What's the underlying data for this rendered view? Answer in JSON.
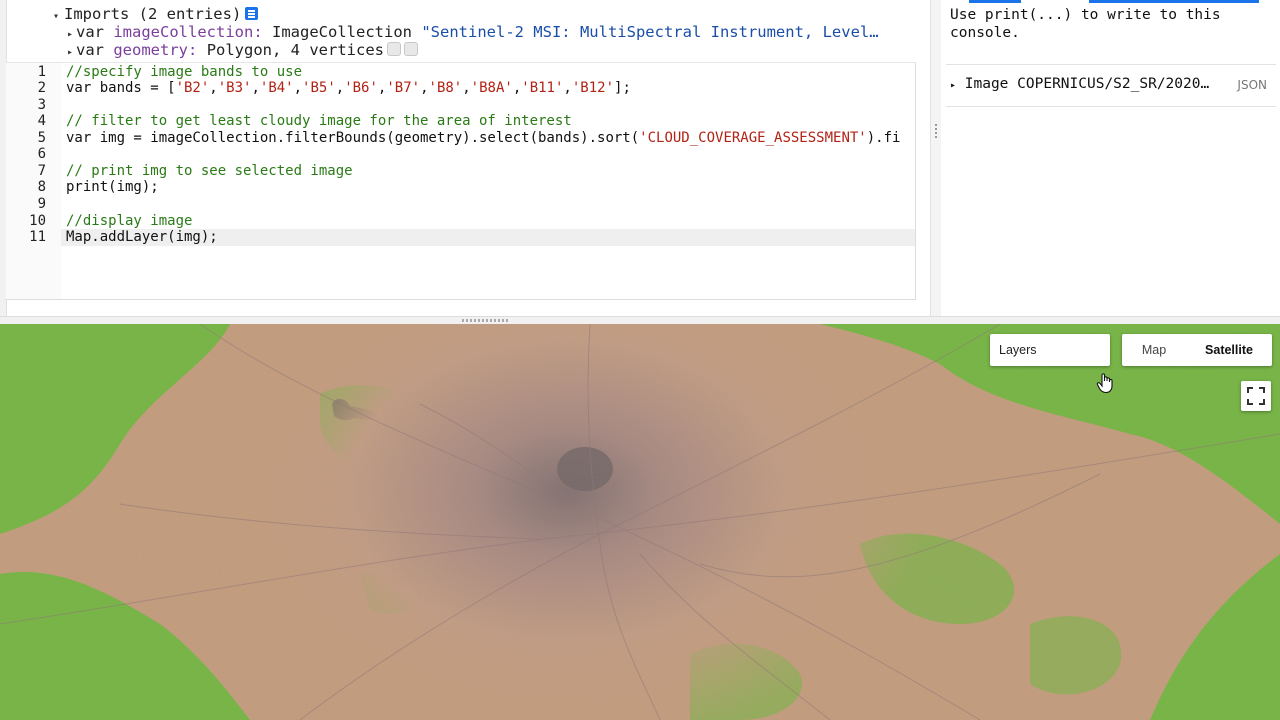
{
  "imports": {
    "header": "Imports (2 entries)",
    "line1": {
      "keyword": "var",
      "name": "imageCollection:",
      "type": "ImageCollection",
      "value": "\"Sentinel-2 MSI: MultiSpectral Instrument, Level…"
    },
    "line2": {
      "keyword": "var",
      "name": "geometry:",
      "type": "Polygon, 4 vertices"
    }
  },
  "code": {
    "line_numbers": [
      "1",
      "2",
      "3",
      "4",
      "5",
      "6",
      "7",
      "8",
      "9",
      "10",
      "11"
    ],
    "l1": "//specify image bands to use",
    "l2_pre": "var bands = [",
    "l2_bands": [
      "'B2'",
      "'B3'",
      "'B4'",
      "'B5'",
      "'B6'",
      "'B7'",
      "'B8'",
      "'B8A'",
      "'B11'",
      "'B12'"
    ],
    "l2_post": "];",
    "l4": "// filter to get least cloudy image for the area of interest",
    "l5_a": "var img = imageCollection.filterBounds(geometry).select(bands).sort(",
    "l5_str": "'CLOUD_COVERAGE_ASSESSMENT'",
    "l5_b": ").fi",
    "l7": "// print img to see selected image",
    "l8": "print(img);",
    "l10": "//display image",
    "l11": "Map.addLayer(img);"
  },
  "console": {
    "message": "Use print(...) to write to this console.",
    "item_label": "Image COPERNICUS/S2_SR/2020…",
    "item_json": "JSON"
  },
  "map": {
    "layers_label": "Layers",
    "map_label": "Map",
    "satellite_label": "Satellite",
    "fullscreen_icon": "fullscreen-icon",
    "colors": {
      "urban": "#c49a7f",
      "vegetation": "#6fc13d",
      "water": "#0f4a2a"
    }
  }
}
